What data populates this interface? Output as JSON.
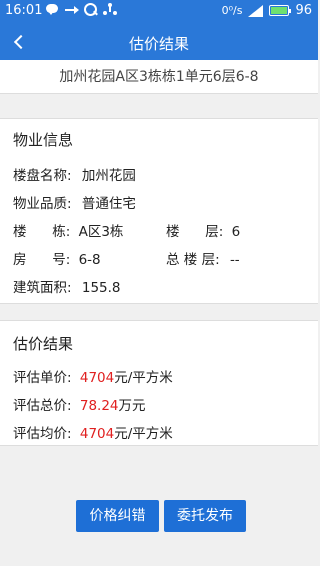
{
  "status": {
    "time": "16:01",
    "data_rate": "0⁰/s",
    "battery_pct": "96"
  },
  "nav": {
    "title": "估价结果"
  },
  "address": "加州花园A区3栋栋1单元6层6-8",
  "property": {
    "heading": "物业信息",
    "name_label": "楼盘名称:",
    "name_value": "加州花园",
    "quality_label": "物业品质:",
    "quality_value": "普通住宅",
    "building_label": "楼      栋:",
    "building_value": "A区3栋",
    "floor_label": "楼      层:",
    "floor_value": "6",
    "room_label": "房      号:",
    "room_value": "6-8",
    "total_floor_label": "总 楼 层:",
    "total_floor_value": "--",
    "area_label": "建筑面积:",
    "area_value": "155.8"
  },
  "estimate": {
    "heading": "估价结果",
    "unit_label": "评估单价:",
    "unit_value": "4704",
    "unit_suffix": "元/平方米",
    "total_label": "评估总价:",
    "total_value": "78.24",
    "total_suffix": "万元",
    "avg_label": "评估均价:",
    "avg_value": "4704",
    "avg_suffix": "元/平方米"
  },
  "buttons": {
    "correct": "价格纠错",
    "publish": "委托发布"
  },
  "colors": {
    "primary": "#2a78d8",
    "button": "#1e6fd6",
    "highlight": "#e02020"
  }
}
